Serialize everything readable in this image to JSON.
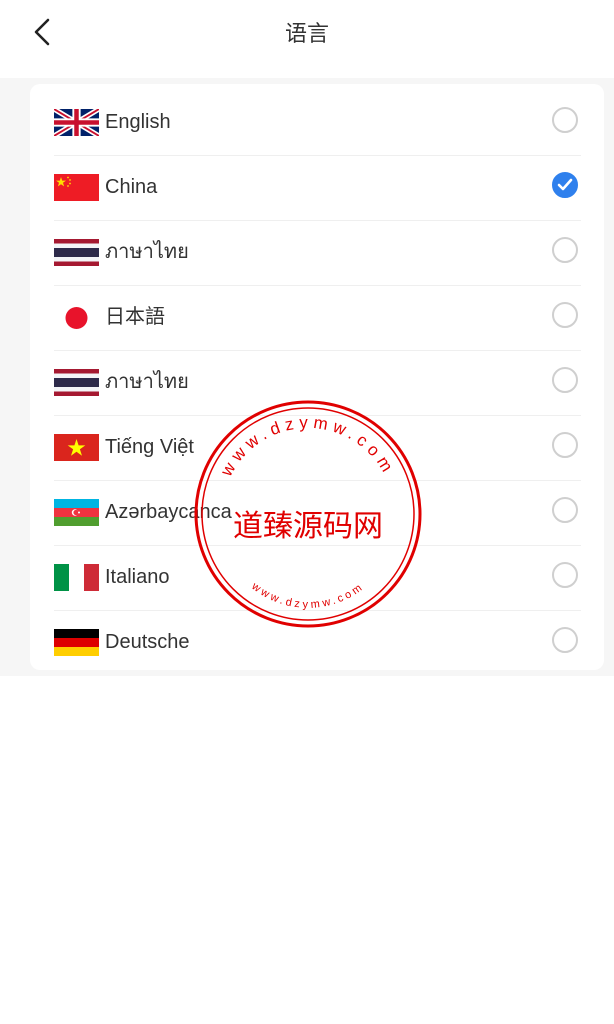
{
  "header": {
    "title": "语言",
    "back_icon": "chevron-left-icon"
  },
  "languages": [
    {
      "label": "English",
      "flag": "uk-flag-icon",
      "selected": false
    },
    {
      "label": "China",
      "flag": "china-flag-icon",
      "selected": true
    },
    {
      "label": "ภาษาไทย",
      "flag": "thailand-flag-icon",
      "selected": false
    },
    {
      "label": "日本語",
      "flag": "japan-flag-icon",
      "selected": false
    },
    {
      "label": "ภาษาไทย",
      "flag": "thailand-flag-icon",
      "selected": false
    },
    {
      "label": "Tiếng Việt",
      "flag": "vietnam-flag-icon",
      "selected": false
    },
    {
      "label": "Azərbaycanca",
      "flag": "azerbaijan-flag-icon",
      "selected": false
    },
    {
      "label": "Italiano",
      "flag": "italy-flag-icon",
      "selected": false
    },
    {
      "label": "Deutsche",
      "flag": "germany-flag-icon",
      "selected": false
    }
  ],
  "watermark": {
    "center_text": "道臻源码网",
    "outer_ring_text": "www.dzymw.com",
    "inner_ring_text": "www.dzymw.com",
    "color": "#e00000"
  },
  "colors": {
    "accent": "#2f80ed",
    "background": "#f6f6f6"
  }
}
